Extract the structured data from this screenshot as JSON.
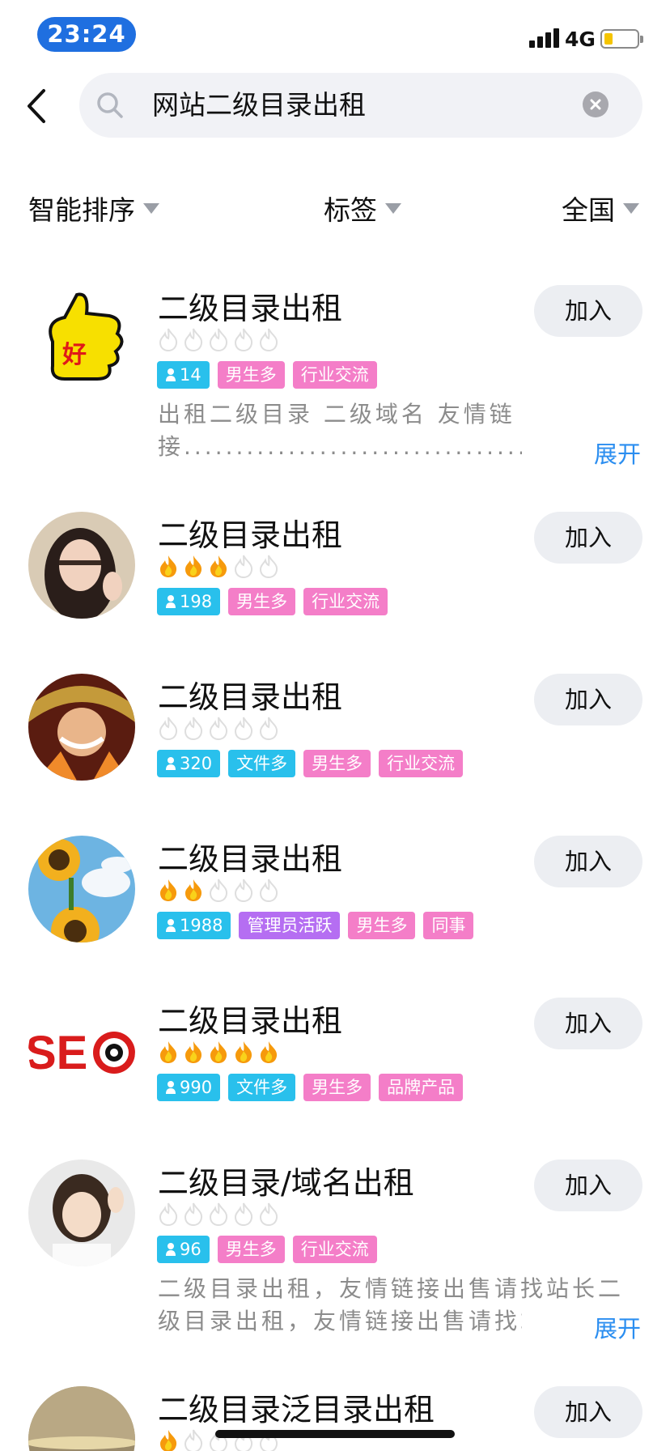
{
  "status_bar": {
    "time": "23:24",
    "network": "4G",
    "battery_level": 0.25,
    "battery_color": "#f5c400",
    "time_pill_color": "#1f6fe0"
  },
  "search": {
    "query": "网站二级目录出租",
    "back_icon": "chevron-left-icon",
    "search_icon": "search-icon",
    "clear_icon": "clear-icon"
  },
  "filters": [
    {
      "label": "智能排序"
    },
    {
      "label": "标签"
    },
    {
      "label": "全国"
    }
  ],
  "tag_colors": {
    "count": "#29c0ec",
    "file": "#29c0ec",
    "admin": "#b56ef2",
    "pink": "#f47ec8"
  },
  "join_label": "加入",
  "expand_label": "展开",
  "results": [
    {
      "title": "二级目录出租",
      "avatar": "thumbs-up-avatar",
      "flames": 0,
      "members": "14",
      "tags": [
        "男生多",
        "行业交流"
      ],
      "description": [
        "出租二级目录 二级域名 友情链",
        "接................................................"
      ]
    },
    {
      "title": "二级目录出租",
      "avatar": "girl-portrait-avatar",
      "flames": 3,
      "members": "198",
      "tags": [
        "男生多",
        "行业交流"
      ]
    },
    {
      "title": "二级目录出租",
      "avatar": "anime-character-avatar",
      "flames": 0,
      "members": "320",
      "tags": [
        "文件多",
        "男生多",
        "行业交流"
      ]
    },
    {
      "title": "二级目录出租",
      "avatar": "sunflower-avatar",
      "flames": 2,
      "members": "1988",
      "tags": [
        "管理员活跃",
        "男生多",
        "同事"
      ]
    },
    {
      "title": "二级目录出租",
      "avatar": "seo-logo-avatar",
      "flames": 5,
      "members": "990",
      "tags": [
        "文件多",
        "男生多",
        "品牌产品"
      ]
    },
    {
      "title": "二级目录/域名出租",
      "avatar": "girl-peace-sign-avatar",
      "flames": 0,
      "members": "96",
      "tags": [
        "男生多",
        "行业交流"
      ],
      "description": [
        "二级目录出租，友情链接出售请找站长二",
        "级目录出租，友情链接出售请找站长"
      ]
    },
    {
      "title": "二级目录泛目录出租",
      "avatar": "sunset-avatar",
      "flames": 1,
      "members": "",
      "tags": []
    }
  ]
}
